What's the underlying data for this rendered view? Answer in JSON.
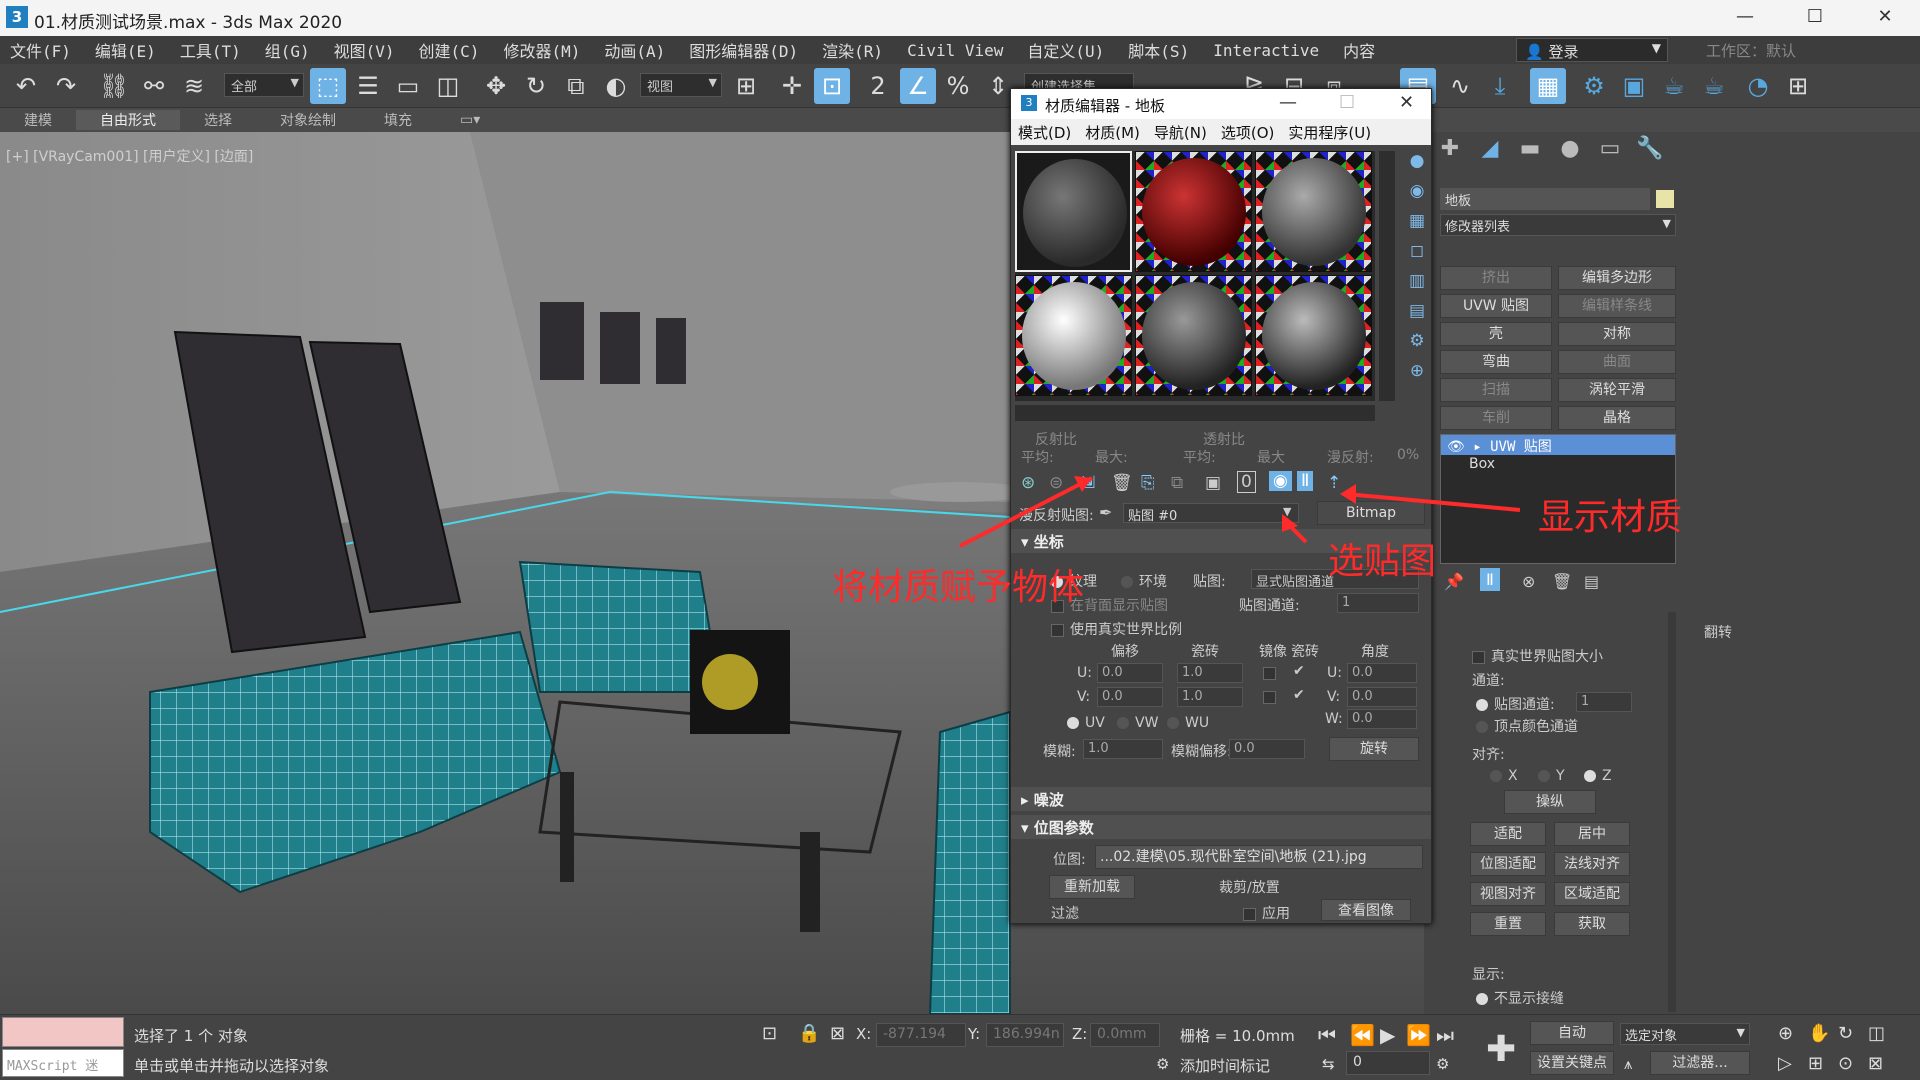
{
  "window": {
    "title": "01.材质测试场景.max - 3ds Max 2020",
    "buttons": [
      "—",
      "☐",
      "✕"
    ]
  },
  "menubar": {
    "items": [
      "文件(F)",
      "编辑(E)",
      "工具(T)",
      "组(G)",
      "视图(V)",
      "创建(C)",
      "修改器(M)",
      "动画(A)",
      "图形编辑器(D)",
      "渲染(R)",
      "Civil View",
      "自定义(U)",
      "脚本(S)",
      "Interactive",
      "内容"
    ],
    "login": "登录",
    "workspace": "工作区：默认"
  },
  "toolbar": {
    "filter_combo": "全部",
    "view_combo": "视图",
    "selection_set": "创建选择集"
  },
  "ribbon": {
    "tabs": [
      "建模",
      "自由形式",
      "选择",
      "对象绘制",
      "填充"
    ]
  },
  "viewport": {
    "label": "[+] [VRayCam001] [用户定义] [边面]"
  },
  "annotations": {
    "assign": "将材质赋予物体",
    "pick_map": "选贴图",
    "show_material": "显示材质"
  },
  "material_editor": {
    "title": "材质编辑器 - 地板",
    "menu": [
      "模式(D)",
      "材质(M)",
      "导航(N)",
      "选项(O)",
      "实用程序(U)"
    ],
    "reflect_label": "反射比",
    "transmit_label": "透射比",
    "avg": "平均:",
    "max": "最大:",
    "avg2": "平均:",
    "max2": "最大",
    "diffuse_reflect": "漫反射:",
    "diffuse_value": "0%",
    "map_label": "漫反射贴图:",
    "map_name": "贴图 #0",
    "map_type": "Bitmap",
    "coords": {
      "header": "坐标",
      "texture": "纹理",
      "env": "环境",
      "mapping_label": "贴图:",
      "mapping_value": "显式贴图通道",
      "show_back": "在背面显示贴图",
      "channel_label": "贴图通道:",
      "channel_value": "1",
      "real_world": "使用真实世界比例",
      "col_offset": "偏移",
      "col_tiling": "瓷砖",
      "col_mirror": "镜像",
      "col_tile": "瓷砖",
      "col_angle": "角度",
      "u": "U:",
      "v": "V:",
      "w": "W:",
      "u_offset": "0.0",
      "v_offset": "0.0",
      "u_tiling": "1.0",
      "v_tiling": "1.0",
      "u_angle": "0.0",
      "v_angle": "0.0",
      "w_angle": "0.0",
      "uv": "UV",
      "vw": "VW",
      "wu": "WU",
      "blur_label": "模糊:",
      "blur_value": "1.0",
      "blur_offset_label": "模糊偏移:",
      "blur_offset_value": "0.0",
      "rotate_btn": "旋转"
    },
    "noise_header": "噪波",
    "bitmap": {
      "header": "位图参数",
      "path_label": "位图:",
      "path": "...02.建模\\05.现代卧室空间\\地板 (21).jpg",
      "reload": "重新加载",
      "crop": "裁剪/放置",
      "apply": "应用",
      "view_image": "查看图像",
      "filter": "过滤"
    }
  },
  "command_panel": {
    "object_name": "地板",
    "modifier_list": "修改器列表",
    "buttons": [
      "挤出",
      "编辑多边形",
      "UVW 贴图",
      "编辑样条线",
      "壳",
      "对称",
      "弯曲",
      "曲面",
      "扫描",
      "涡轮平滑",
      "车削",
      "晶格"
    ],
    "stack": [
      "UVW 贴图",
      "Box"
    ],
    "params": {
      "flip": "翻转",
      "real_world": "真实世界贴图大小",
      "channel_header": "通道:",
      "map_channel": "贴图通道:",
      "map_channel_value": "1",
      "vertex_color": "顶点颜色通道",
      "align_header": "对齐:",
      "x": "X",
      "y": "Y",
      "z": "Z",
      "manipulate": "操纵",
      "fit": "适配",
      "center": "居中",
      "bitmap_fit": "位图适配",
      "normal_align": "法线对齐",
      "view_align": "视图对齐",
      "region_fit": "区域适配",
      "reset": "重置",
      "acquire": "获取",
      "display_header": "显示:",
      "no_seams": "不显示接缝"
    }
  },
  "statusbar": {
    "maxscript": "MAXScript 迷",
    "selected": "选择了 1 个 对象",
    "hint": "单击或单击并拖动以选择对象",
    "x_label": "X:",
    "x_value": "-877.194",
    "y_label": "Y:",
    "y_value": "186.994n",
    "z_label": "Z:",
    "z_value": "0.0mm",
    "grid": "栅格 = 10.0mm",
    "add_time_tag": "添加时间标记",
    "auto": "自动",
    "selected_obj": "选定对象",
    "set_key": "设置关键点",
    "filters": "过滤器...",
    "frame": "0"
  }
}
